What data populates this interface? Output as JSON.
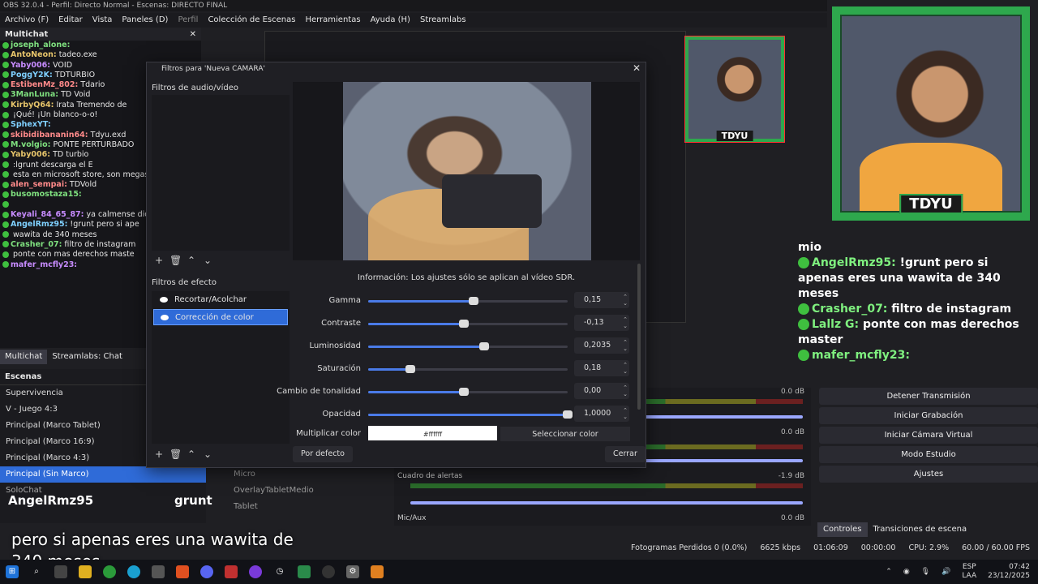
{
  "window": {
    "title": "OBS 32.0.4 - Perfil: Directo Normal - Escenas: DIRECTO FINAL"
  },
  "menu": [
    "Archivo (F)",
    "Editar",
    "Vista",
    "Paneles (D)",
    "Perfil",
    "Colección de Escenas",
    "Herramientas",
    "Ayuda (H)",
    "Streamlabs"
  ],
  "multichat": {
    "title": "Multichat",
    "lines": [
      {
        "user": "joseph_alone:",
        "text": ""
      },
      {
        "user": "AntoNeon:",
        "text": "tadeo.exe"
      },
      {
        "user": "Yaby006:",
        "text": "VOID"
      },
      {
        "user": "PoggY2K:",
        "text": "TDTURBIO"
      },
      {
        "user": "EstibenMz_802:",
        "text": "Tdario"
      },
      {
        "user": "3ManLuna:",
        "text": "TD Void"
      },
      {
        "user": "KirbyQ64:",
        "text": "Irata Tremendo de"
      },
      {
        "user": "",
        "text": "¡Qué! ¡Un blanco-o-o!"
      },
      {
        "user": "SphexYT:",
        "text": ""
      },
      {
        "user": "skibidibananin64:",
        "text": "Tdyu.exd"
      },
      {
        "user": "M.volgio:",
        "text": "PONTE PERTURBADO"
      },
      {
        "user": "Yaby006:",
        "text": "TD turbio"
      },
      {
        "user": "",
        "text": ":lgrunt descarga el E"
      },
      {
        "user": "",
        "text": "esta en microsoft store, son megas y es gra"
      },
      {
        "user": "alen_sempai:",
        "text": "TDVold"
      },
      {
        "user": "busomostaza15:",
        "text": ""
      },
      {
        "user": "",
        "text": ""
      },
      {
        "user": "Keyali_84_65_87:",
        "text": "ya calmense dios m"
      },
      {
        "user": "AngelRmz95:",
        "text": "!grunt pero si ape"
      },
      {
        "user": "",
        "text": "wawita de 340 meses"
      },
      {
        "user": "Crasher_07:",
        "text": "filtro de instagram"
      },
      {
        "user": "",
        "text": "ponte con mas derechos maste"
      },
      {
        "user": "mafer_mcfly23:",
        "text": ""
      }
    ],
    "tabs": [
      "Multichat",
      "Streamlabs: Chat"
    ]
  },
  "scenes": {
    "title": "Escenas",
    "items": [
      "Supervivencia",
      "V - Juego 4:3",
      "Principal (Marco Tablet)",
      "Principal (Marco 16:9)",
      "Principal (Marco 4:3)",
      "Principal (Sin Marco)"
    ],
    "selected_index": 5,
    "other": [
      "SoloChat",
      "Principal"
    ]
  },
  "sources": [
    "Micro",
    "OverlayTabletMedio",
    "Tablet",
    "grunt"
  ],
  "mixer": {
    "tracks": [
      {
        "name": "",
        "db": "0.0 dB"
      },
      {
        "name": "",
        "db": "0.0 dB"
      },
      {
        "name": "Cuadro de alertas",
        "db": "-1.9 dB"
      },
      {
        "name": "Mic/Aux",
        "db": "0.0 dB"
      }
    ],
    "scale": [
      "-60",
      "-55",
      "-50",
      "-45",
      "-40",
      "-35",
      "-30",
      "-25",
      "-20",
      "-15",
      "-10",
      "-5",
      "0"
    ]
  },
  "controls": {
    "buttons": [
      "Detener Transmisión",
      "Iniciar Grabación",
      "Iniciar Cámara Virtual",
      "Modo Estudio",
      "Ajustes"
    ],
    "tabs": [
      "Controles",
      "Transiciones de escena"
    ]
  },
  "status": {
    "frames": "Fotogramas Perdidos 0 (0.0%)",
    "kbps": "6625 kbps",
    "live": "01:06:09",
    "rec": "00:00:00",
    "cpu": "CPU: 2.9%",
    "fps": "60.00 / 60.00 FPS"
  },
  "taskbar": {
    "lang": "ESP",
    "lang2": "LAA",
    "time": "07:42",
    "date": "23/12/2025"
  },
  "webcam": {
    "tag": "TDYU"
  },
  "overlay_chat": [
    {
      "user": "",
      "text": "mio"
    },
    {
      "user": "AngelRmz95:",
      "text": "!grunt pero si apenas eres una wawita de 340 meses"
    },
    {
      "user": "Crasher_07:",
      "text": "filtro de instagram"
    },
    {
      "user": "Lallz G:",
      "text": "ponte con mas derechos master"
    },
    {
      "user": "mafer_mcfly23:",
      "text": ""
    }
  ],
  "nameplate": {
    "name": "AngelRmz95",
    "grunt": "grunt"
  },
  "subtitle": "pero si apenas eres una wawita de 340 meses",
  "dialog": {
    "title": "Filtros para 'Nueva CAMARA'",
    "av_label": "Filtros de audio/vídeo",
    "efx_label": "Filtros de efecto",
    "effects": [
      "Recortar/Acolchar",
      "Corrección de color"
    ],
    "selected_effect": 1,
    "info": "Información: Los ajustes sólo se aplican al vídeo SDR.",
    "params": [
      {
        "label": "Gamma",
        "value": "0,15",
        "level": 0.53
      },
      {
        "label": "Contraste",
        "value": "-0,13",
        "level": 0.48
      },
      {
        "label": "Luminosidad",
        "value": "0,2035",
        "level": 0.58
      },
      {
        "label": "Saturación",
        "value": "0,18",
        "level": 0.21
      },
      {
        "label": "Cambio de tonalidad",
        "value": "0,00",
        "level": 0.48
      },
      {
        "label": "Opacidad",
        "value": "1,0000",
        "level": 1.0
      }
    ],
    "multiplier_label": "Multiplicar color",
    "multiplier_value": "#ffffff",
    "select_color": "Seleccionar color",
    "default_btn": "Por defecto",
    "close_btn": "Cerrar"
  }
}
